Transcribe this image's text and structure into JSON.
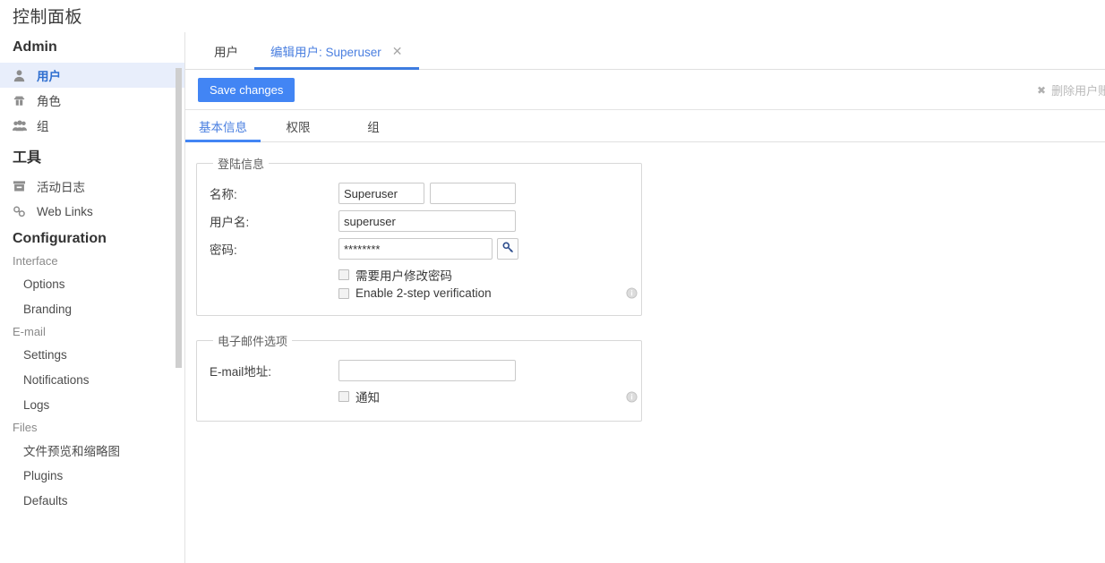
{
  "page": {
    "title": "控制面板"
  },
  "sidebar": {
    "sections": [
      {
        "heading": "Admin",
        "type": "icon-list",
        "items": [
          {
            "label": "用户",
            "icon": "user-icon",
            "active": true
          },
          {
            "label": "角色",
            "icon": "role-spy-icon",
            "active": false
          },
          {
            "label": "组",
            "icon": "group-icon",
            "active": false
          }
        ]
      },
      {
        "heading": "工具",
        "type": "icon-list",
        "items": [
          {
            "label": "活动日志",
            "icon": "activity-log-icon",
            "active": false
          },
          {
            "label": "Web Links",
            "icon": "link-icon",
            "active": false
          }
        ]
      },
      {
        "heading": "Configuration",
        "type": "plain",
        "groups": [
          {
            "subheading": "Interface",
            "items": [
              "Options",
              "Branding"
            ]
          },
          {
            "subheading": "E-mail",
            "items": [
              "Settings",
              "Notifications",
              "Logs"
            ]
          },
          {
            "subheading": "Files",
            "items": [
              "文件预览和缩略图",
              "Plugins",
              "Defaults"
            ]
          }
        ]
      }
    ]
  },
  "main": {
    "tabs": [
      {
        "label": "用户",
        "active": false,
        "closable": false
      },
      {
        "label": "编辑用户: Superuser",
        "active": true,
        "closable": true,
        "close": "✕"
      }
    ],
    "toolbar": {
      "save_label": "Save changes",
      "delete_label": "删除用户账",
      "delete_icon": "✖"
    },
    "subtabs": [
      {
        "label": "基本信息",
        "active": true
      },
      {
        "label": "权限",
        "active": false
      },
      {
        "label": "组",
        "active": false
      }
    ],
    "login_group": {
      "legend": "登陆信息",
      "name_label": "名称:",
      "name_first_value": "Superuser",
      "name_last_value": "",
      "username_label": "用户名:",
      "username_value": "superuser",
      "password_label": "密码:",
      "password_value": "********",
      "password_button_icon": "key-icon",
      "force_change_label": "需要用户修改密码",
      "force_change_checked": false,
      "two_step_label": "Enable 2-step verification",
      "two_step_checked": false,
      "info_icon": "info-icon"
    },
    "email_group": {
      "legend": "电子邮件选项",
      "email_label": "E-mail地址:",
      "email_value": "",
      "notify_label": "通知",
      "notify_checked": false,
      "info_icon": "info-icon"
    }
  },
  "colors": {
    "accent": "#4285f4",
    "active_tab_text": "#4a7fe0",
    "sidebar_active_bg": "#e8eefb"
  }
}
